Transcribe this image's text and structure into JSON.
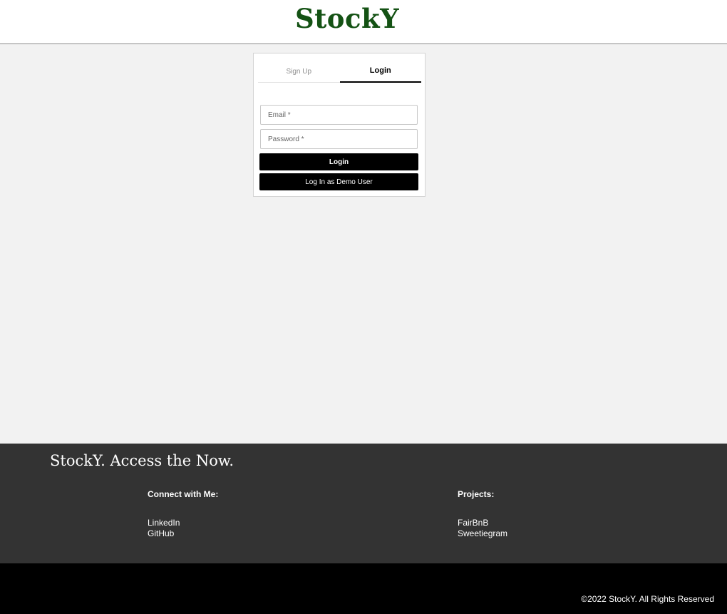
{
  "header": {
    "logo": "StockY"
  },
  "auth": {
    "tabs": [
      {
        "label": "Sign Up",
        "active": false
      },
      {
        "label": "Login",
        "active": true
      }
    ],
    "email_placeholder": "Email *",
    "password_placeholder": "Password *",
    "login_button": "Login",
    "demo_button": "Log In as Demo User"
  },
  "footer": {
    "tagline": "StockY. Access the Now.",
    "connect": {
      "heading": "Connect with Me:",
      "links": [
        "LinkedIn",
        "GitHub"
      ]
    },
    "projects": {
      "heading": "Projects:",
      "links": [
        "FairBnB",
        "Sweetiegram"
      ]
    },
    "copyright": "©2022 StockY. All Rights Reserved"
  },
  "colors": {
    "brand_green": "#145214",
    "footer_dark": "#333333",
    "page_background": "#f2f2f2"
  }
}
